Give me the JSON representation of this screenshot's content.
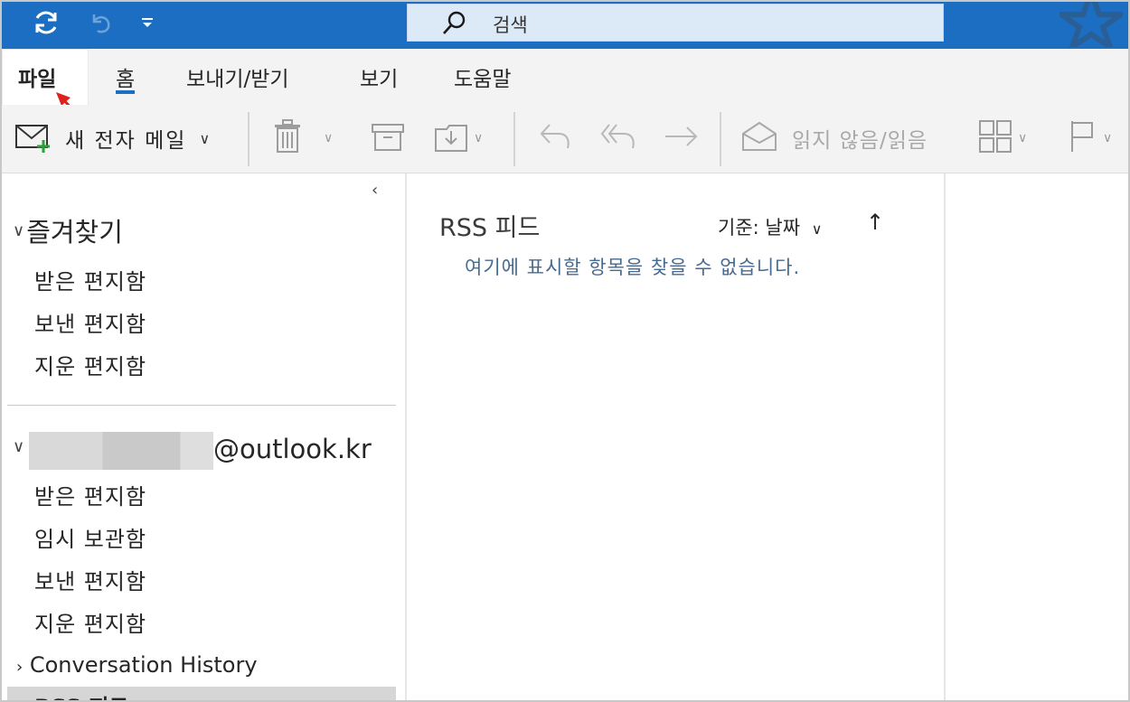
{
  "titlebar": {
    "qat": [
      "sync-icon",
      "undo-icon",
      "customize-qat-icon"
    ],
    "search_placeholder": "검색",
    "accent": "#1b6ec2"
  },
  "tabs": {
    "file": "파일",
    "home": "홈",
    "send_receive": "보내기/받기",
    "view": "보기",
    "help": "도움말"
  },
  "ribbon": {
    "new_email": "새 전자 메일",
    "read_unread": "읽지 않음/읽음",
    "icons": [
      "new-mail-icon",
      "delete-icon",
      "archive-icon",
      "move-icon",
      "reply-icon",
      "reply-all-icon",
      "forward-icon",
      "envelope-open-icon",
      "categorize-icon",
      "flag-icon"
    ]
  },
  "folders": {
    "favorites_title": "즐겨찾기",
    "favorites": [
      "받은 편지함",
      "보낸 편지함",
      "지운 편지함"
    ],
    "account_name": "@outlook.kr",
    "account_folders": [
      "받은 편지함",
      "임시 보관함",
      "보낸 편지함",
      "지운 편지함"
    ],
    "conversation_history": "Conversation History",
    "rss_feed": "RSS 피드"
  },
  "list": {
    "title": "RSS 피드",
    "sort_label": "기준: 날짜",
    "empty_message": "여기에 표시할 항목을 찾을 수 없습니다."
  }
}
